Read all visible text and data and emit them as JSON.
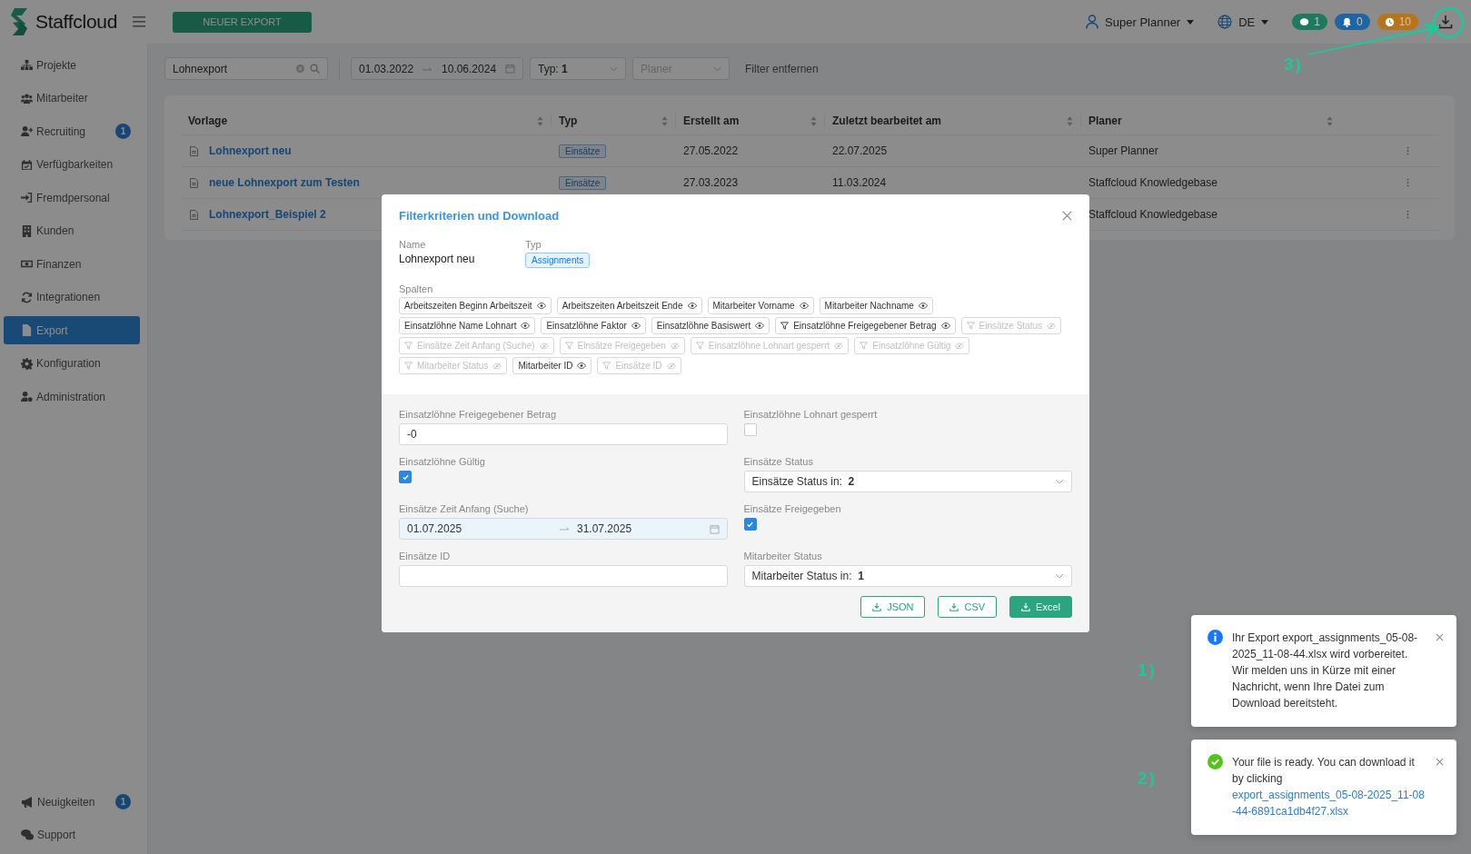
{
  "app": {
    "logo": "Staffcloud",
    "new_button": "NEUER EXPORT"
  },
  "topbar": {
    "user": "Super Planner",
    "language": "DE",
    "counters": [
      {
        "kind": "chat",
        "count": "1",
        "color": "#1e7a5e"
      },
      {
        "kind": "bell",
        "count": "0",
        "color": "#1f64a3"
      },
      {
        "kind": "clock",
        "count": "10",
        "color": "#b8741a"
      }
    ]
  },
  "sidebar": {
    "items": [
      {
        "label": "Projekte",
        "selected": false
      },
      {
        "label": "Mitarbeiter",
        "selected": false
      },
      {
        "label": "Recruiting",
        "badge": "1",
        "selected": false
      },
      {
        "label": "Verfügbarkeiten",
        "selected": false
      },
      {
        "label": "Fremdpersonal",
        "selected": false
      },
      {
        "label": "Kunden",
        "selected": false
      },
      {
        "label": "Finanzen",
        "selected": false
      },
      {
        "label": "Integrationen",
        "selected": false
      },
      {
        "label": "Export",
        "selected": true
      },
      {
        "label": "Konfiguration",
        "selected": false
      },
      {
        "label": "Administration",
        "selected": false
      }
    ],
    "bottom_items": [
      {
        "label": "Neuigkeiten",
        "badge": "1",
        "selected": false
      },
      {
        "label": "Support",
        "selected": false
      }
    ]
  },
  "filters": {
    "search": "Lohnexport",
    "date_from": "01.03.2022",
    "date_to": "10.06.2024",
    "type_label": "Typ:",
    "type_value": "1",
    "planner_placeholder": "Planer",
    "clear": "Filter entfernen"
  },
  "table": {
    "columns": [
      "Vorlage",
      "Typ",
      "Erstellt am",
      "Zuletzt bearbeitet am",
      "Planer"
    ],
    "rows": [
      {
        "template": "Lohnexport neu",
        "type": "Einsätze",
        "created": "27.05.2022",
        "edited": "22.07.2025",
        "planner": "Super Planner"
      },
      {
        "template": "neue Lohnexport zum Testen",
        "type": "Einsätze",
        "created": "27.03.2023",
        "edited": "11.03.2024",
        "planner": "Staffcloud Knowledgebase"
      },
      {
        "template": "Lohnexport_Beispiel 2",
        "planner": "Staffcloud Knowledgebase"
      }
    ]
  },
  "modal": {
    "title": "Filterkriterien und Download",
    "name_label": "Name",
    "name": "Lohnexport neu",
    "type_label": "Typ",
    "type": "Assignments",
    "columns_label": "Spalten",
    "columns": [
      {
        "label": "Arbeitszeiten Beginn Arbeitszeit",
        "filter": false,
        "visible": true
      },
      {
        "label": "Arbeitszeiten Arbeitszeit Ende",
        "filter": false,
        "visible": true
      },
      {
        "label": "Mitarbeiter Vorname",
        "filter": false,
        "visible": true
      },
      {
        "label": "Mitarbeiter Nachname",
        "filter": false,
        "visible": true
      },
      {
        "label": "Einsatzlöhne Name Lohnart",
        "filter": false,
        "visible": true
      },
      {
        "label": "Einsatzlöhne Faktor",
        "filter": false,
        "visible": true
      },
      {
        "label": "Einsatzlöhne Basiswert",
        "filter": false,
        "visible": true
      },
      {
        "label": "Einsatzlöhne Freigegebener Betrag",
        "filter": true,
        "visible": true
      },
      {
        "label": "Einsätze Status",
        "filter": true,
        "visible": false
      },
      {
        "label": "Einsätze Zeit Anfang (Suche)",
        "filter": true,
        "visible": false
      },
      {
        "label": "Einsätze Freigegeben",
        "filter": true,
        "visible": false
      },
      {
        "label": "Einsatzlöhne Lohnart gesperrt",
        "filter": true,
        "visible": false
      },
      {
        "label": "Einsatzlöhne Gültig",
        "filter": true,
        "visible": false
      },
      {
        "label": "Mitarbeiter Status",
        "filter": true,
        "visible": false
      },
      {
        "label": "Mitarbeiter ID",
        "filter": false,
        "visible": true
      },
      {
        "label": "Einsätze ID",
        "filter": true,
        "visible": false
      }
    ],
    "fields": [
      {
        "kind": "text",
        "label": "Einsatzlöhne Freigegebener Betrag",
        "value": "-0"
      },
      {
        "kind": "checkbox",
        "label": "Einsatzlöhne Lohnart gesperrt",
        "checked": false
      },
      {
        "kind": "checkbox",
        "label": "Einsatzlöhne Gültig",
        "checked": true
      },
      {
        "kind": "select",
        "label": "Einsätze Status",
        "prefix": "Einsätze Status in:",
        "value": "2"
      },
      {
        "kind": "daterange",
        "label": "Einsätze Zeit Anfang (Suche)",
        "from": "01.07.2025",
        "to": "31.07.2025"
      },
      {
        "kind": "checkbox",
        "label": "Einsätze Freigegeben",
        "checked": true
      },
      {
        "kind": "text",
        "label": "Einsätze ID"
      },
      {
        "kind": "select",
        "label": "Mitarbeiter Status",
        "prefix": "Mitarbeiter Status in:",
        "value": "1"
      }
    ],
    "buttons": [
      {
        "label": "JSON",
        "primary": false
      },
      {
        "label": "CSV",
        "primary": false
      },
      {
        "label": "Excel",
        "primary": true
      }
    ]
  },
  "toasts": [
    {
      "kind": "info",
      "text": "Ihr Export export_assignments_05-08-2025_11-08-44.xlsx wird vorbereitet. Wir melden uns in Kürze mit einer Nachricht, wenn Ihre Datei zum Download bereitsteht."
    },
    {
      "kind": "success",
      "text": "Your file is ready. You can download it by clicking",
      "link": "export_assignments_05-08-2025_11-08-44-6891ca1db4f27.xlsx"
    }
  ],
  "annotations": [
    "3)",
    "1)",
    "2)"
  ]
}
